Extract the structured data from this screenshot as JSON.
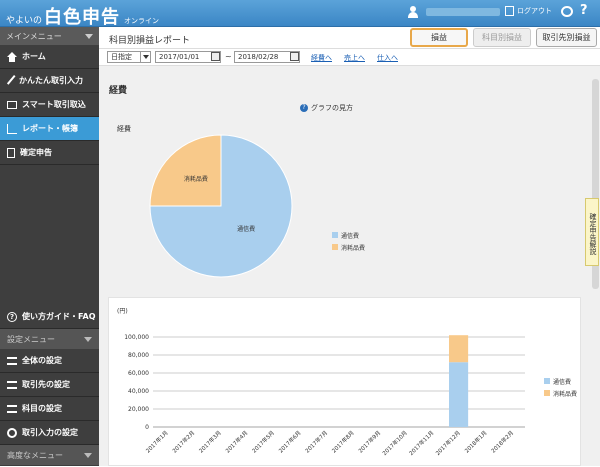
{
  "header": {
    "logo_small": "やよいの",
    "logo_big": "白色申告",
    "logo_sub": "オンライン",
    "logout_label": "ログアウト",
    "help_label": "?"
  },
  "sidebar": {
    "menu_title": "メインメニュー",
    "items": [
      {
        "label": "ホーム",
        "icon": "home-icon"
      },
      {
        "label": "かんたん取引入力",
        "icon": "pencil-icon"
      },
      {
        "label": "スマート取引取込",
        "icon": "card-icon"
      },
      {
        "label": "レポート・帳簿",
        "icon": "chart-icon",
        "active": true
      },
      {
        "label": "確定申告",
        "icon": "document-icon"
      }
    ],
    "guide_label": "使い方ガイド・FAQ",
    "settings_title": "設定メニュー",
    "settings_items": [
      {
        "label": "全体の設定"
      },
      {
        "label": "取引先の設定"
      },
      {
        "label": "科目の設定"
      },
      {
        "label": "取引入力の設定"
      }
    ],
    "advanced_title": "高度なメニュー"
  },
  "main": {
    "page_title": "科目別損益レポート",
    "tabs": [
      "損益",
      "科目別損益",
      "取引先別損益"
    ],
    "filter": {
      "period_select": "日指定",
      "date_from": "2017/01/01",
      "tilde": "~",
      "date_to": "2018/02/28",
      "links": [
        "経費へ",
        "売上へ",
        "仕入へ"
      ]
    },
    "section_title": "経費",
    "graph_help": "グラフの見方",
    "side_tab": "確定申告解説"
  },
  "colors": {
    "accent": "#3b9bd6",
    "series1": "#a9cfee",
    "series2": "#f8c98a",
    "tab_highlight": "#e8a84a"
  },
  "chart_data": [
    {
      "type": "pie",
      "title": "経費",
      "slices": [
        {
          "label": "通信費",
          "value": 75
        },
        {
          "label": "消耗品費",
          "value": 25
        }
      ],
      "legend": [
        "通信費",
        "消耗品費"
      ],
      "legend_placement": "right"
    },
    {
      "type": "bar",
      "stacked": true,
      "unit_label": "(円)",
      "categories": [
        "2017年1月",
        "2017年2月",
        "2017年3月",
        "2017年4月",
        "2017年5月",
        "2017年6月",
        "2017年7月",
        "2017年8月",
        "2017年9月",
        "2017年10月",
        "2017年11月",
        "2017年12月",
        "2018年1月",
        "2018年2月"
      ],
      "series": [
        {
          "name": "通信費",
          "values": [
            0,
            0,
            0,
            0,
            0,
            0,
            0,
            0,
            0,
            0,
            0,
            72000,
            0,
            0
          ]
        },
        {
          "name": "消耗品費",
          "values": [
            0,
            0,
            0,
            0,
            0,
            0,
            0,
            0,
            0,
            0,
            0,
            30000,
            0,
            0
          ]
        }
      ],
      "y_ticks": [
        "0",
        "20,000",
        "40,000",
        "60,000",
        "80,000",
        "100,000"
      ],
      "ylim": [
        0,
        100000
      ],
      "grid": true,
      "legend_placement": "right"
    }
  ]
}
